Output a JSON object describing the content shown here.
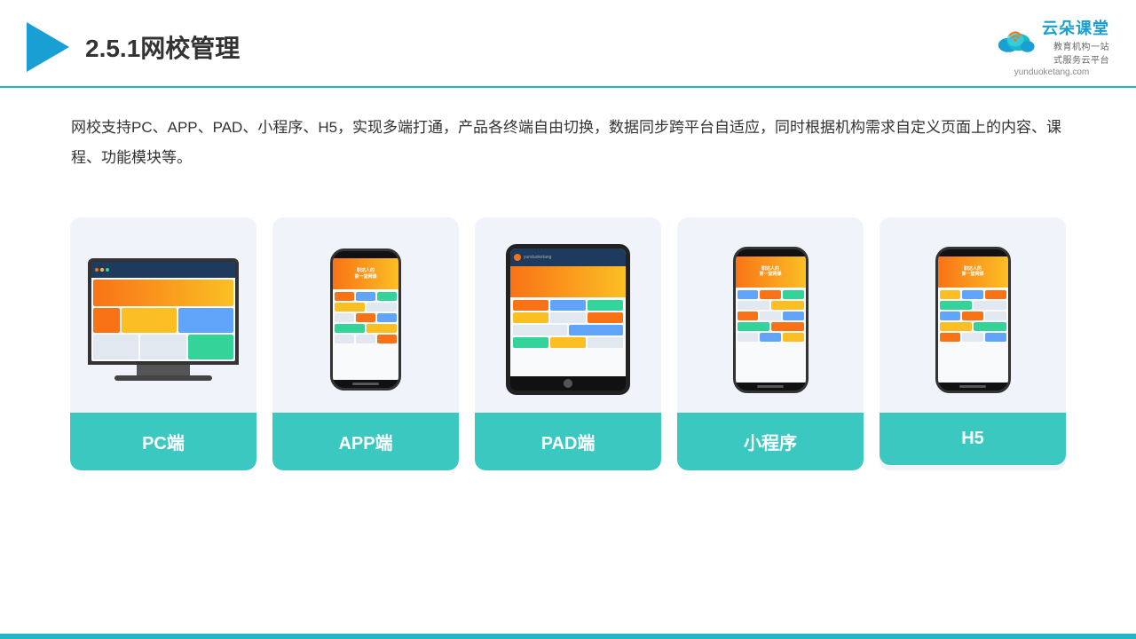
{
  "header": {
    "title": "2.5.1网校管理",
    "logo_main": "云朵课堂",
    "logo_sub": "教育机构一站\n式服务云平台",
    "logo_url": "yunduoketang.com"
  },
  "description": {
    "text": "网校支持PC、APP、PAD、小程序、H5，实现多端打通，产品各终端自由切换，数据同步跨平台自适应，同时根据机构需求自定义页面上的内容、课程、功能模块等。"
  },
  "cards": [
    {
      "id": "pc",
      "label": "PC端"
    },
    {
      "id": "app",
      "label": "APP端"
    },
    {
      "id": "pad",
      "label": "PAD端"
    },
    {
      "id": "mini",
      "label": "小程序"
    },
    {
      "id": "h5",
      "label": "H5"
    }
  ]
}
